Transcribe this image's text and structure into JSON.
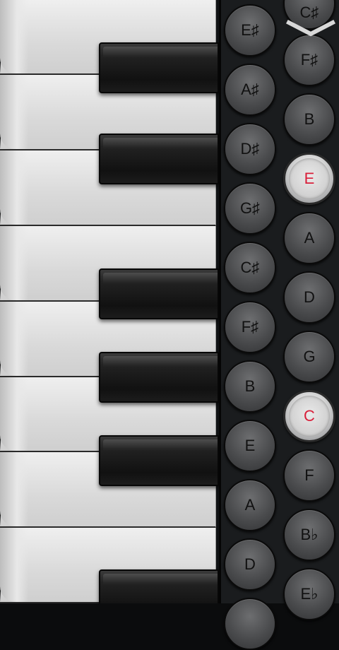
{
  "app": {
    "accent_color": "#d81f3a",
    "collapse_icon": "chevron-down-icon"
  },
  "left_column": [
    {
      "note": "E♯"
    },
    {
      "note": "A♯"
    },
    {
      "note": "D♯"
    },
    {
      "note": "G♯"
    },
    {
      "note": "C♯"
    },
    {
      "note": "F♯"
    },
    {
      "note": "B"
    },
    {
      "note": "E"
    },
    {
      "note": "A"
    },
    {
      "note": "D"
    }
  ],
  "right_column": [
    {
      "note": "C♯",
      "active": false
    },
    {
      "note": "F♯",
      "active": false
    },
    {
      "note": "B",
      "active": false
    },
    {
      "note": "E",
      "active": true
    },
    {
      "note": "A",
      "active": false
    },
    {
      "note": "D",
      "active": false
    },
    {
      "note": "G",
      "active": false
    },
    {
      "note": "C",
      "active": true
    },
    {
      "note": "F",
      "active": false
    },
    {
      "note": "B♭",
      "active": false
    },
    {
      "note": "E♭",
      "active": false
    }
  ]
}
